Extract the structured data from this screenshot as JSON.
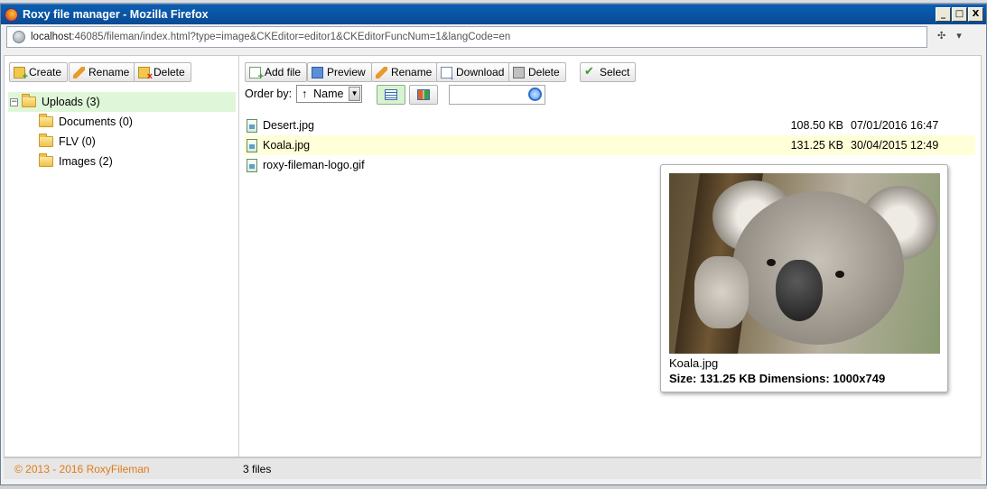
{
  "window": {
    "title": "Roxy file manager - Mozilla Firefox",
    "controls": {
      "minimize": "_",
      "maximize": "□",
      "close": "X"
    }
  },
  "address": {
    "host": "localhost",
    "rest": ":46085/fileman/index.html?type=image&CKEditor=editor1&CKEditorFuncNum=1&langCode=en"
  },
  "folder_toolbar": {
    "create": "Create",
    "rename": "Rename",
    "delete": "Delete"
  },
  "file_toolbar": {
    "add_file": "Add file",
    "preview": "Preview",
    "rename": "Rename",
    "download": "Download",
    "delete": "Delete",
    "select": "Select"
  },
  "tree": {
    "root": "Uploads (3)",
    "children": [
      "Documents (0)",
      "FLV (0)",
      "Images (2)"
    ]
  },
  "sort": {
    "label": "Order by:",
    "direction": "↑",
    "value": "Name"
  },
  "files": [
    {
      "name": "Desert.jpg",
      "size": "108.50 KB",
      "date": "07/01/2016 16:47"
    },
    {
      "name": "Koala.jpg",
      "size": "131.25 KB",
      "date": "30/04/2015 12:49"
    },
    {
      "name": "roxy-fileman-logo.gif",
      "size": "",
      "date": ""
    }
  ],
  "preview": {
    "name": "Koala.jpg",
    "meta": "Size: 131.25 KB Dimensions: 1000x749"
  },
  "status": {
    "copyright": "© 2013 - 2016 RoxyFileman",
    "count": "3 files"
  },
  "colors": {
    "selected_row": "#ffffd8",
    "tree_selected": "#dff7d8",
    "titlebar": "#0a5fb4",
    "copyright": "#e07a1a"
  }
}
